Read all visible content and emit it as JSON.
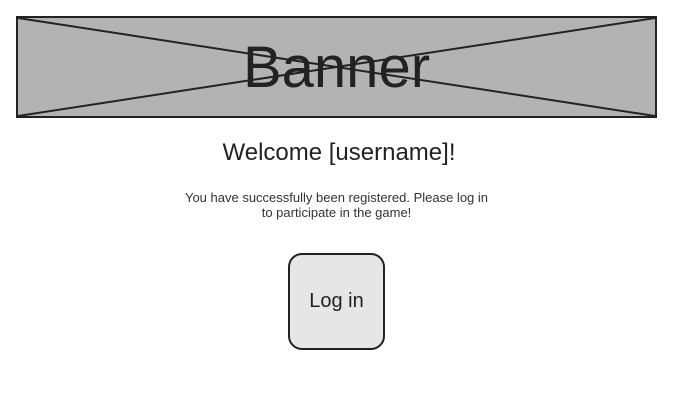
{
  "banner": {
    "label": "Banner",
    "background": "#b3b3b3",
    "border": "#222222"
  },
  "welcome": {
    "title": "Welcome [username]!"
  },
  "message": {
    "text": "You have successfully been registered. Please log in to participate in the game!"
  },
  "actions": {
    "login_label": "Log in",
    "button_background": "#e6e6e6"
  }
}
